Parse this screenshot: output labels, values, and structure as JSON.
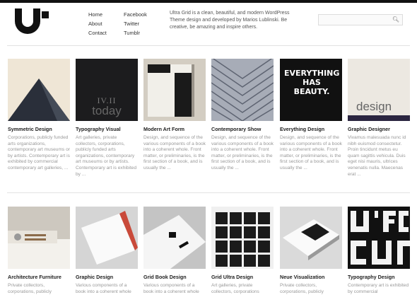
{
  "nav": {
    "col1": [
      "Home",
      "About",
      "Contact"
    ],
    "col2": [
      "Facebook",
      "Twitter",
      "Tumblr"
    ]
  },
  "about_text": "Ultra Grid is a clean, beautiful, and modern WordPress Theme design and developed by Marios Lublinski. Be creative, be amazing and inspire others.",
  "search": {
    "placeholder": "",
    "icon": "search-icon"
  },
  "thumb_text": {
    "typo_line1": "IV.II",
    "typo_line2": "today",
    "everything": "EVERYTHING HAS BEAUTY.",
    "design": "design"
  },
  "row1": [
    {
      "title": "Symmetric Design",
      "desc": "Corporations, publicly funded arts organizations, contemporary art museums or by artists. Contemporary art is exhibited by commercial contemporary art galleries, ..."
    },
    {
      "title": "Typography Visual",
      "desc": "Art galleries, private collectors, corporations, publicly funded arts organizations, contemporary art museums or by artists. Contemporary art is exhibited by ..."
    },
    {
      "title": "Modern Art Form",
      "desc": "Design, and sequence of the various components of a book into a coherent whole. Front matter, or preliminaries, is the first section of a book, and is usually the ..."
    },
    {
      "title": "Contemporary Show",
      "desc": "Design, and sequence of the various components of a book into a coherent whole. Front matter, or preliminaries, is the first section of a book, and is usually the ..."
    },
    {
      "title": "Everything Design",
      "desc": "Design, and sequence of the various components of a book into a coherent whole. Front matter, or preliminaries, is the first section of a book, and is usually the ..."
    },
    {
      "title": "Graphic Designer",
      "desc": "Vivamus malesuada nunc id nibh euismod consectetur. Proin tincidunt metus eu quam sagittis vehicula. Duis eget nisi mauris, ultrices venenatis nulla. Maecenas erat ..."
    }
  ],
  "row2": [
    {
      "title": "Architecture Furniture",
      "desc": "Private collectors, corporations, publicly"
    },
    {
      "title": "Graphic Design",
      "desc": "Various components of a book into a coherent whole"
    },
    {
      "title": "Grid Book Design",
      "desc": "Various components of a book into a coherent whole"
    },
    {
      "title": "Grid Ultra Design",
      "desc": "Art galleries, private collectors, corporations"
    },
    {
      "title": "Neue Visualization",
      "desc": "Private collectors, corporations, publicly"
    },
    {
      "title": "Typography Design",
      "desc": "Contemporary art is exhibited by commercial"
    }
  ]
}
